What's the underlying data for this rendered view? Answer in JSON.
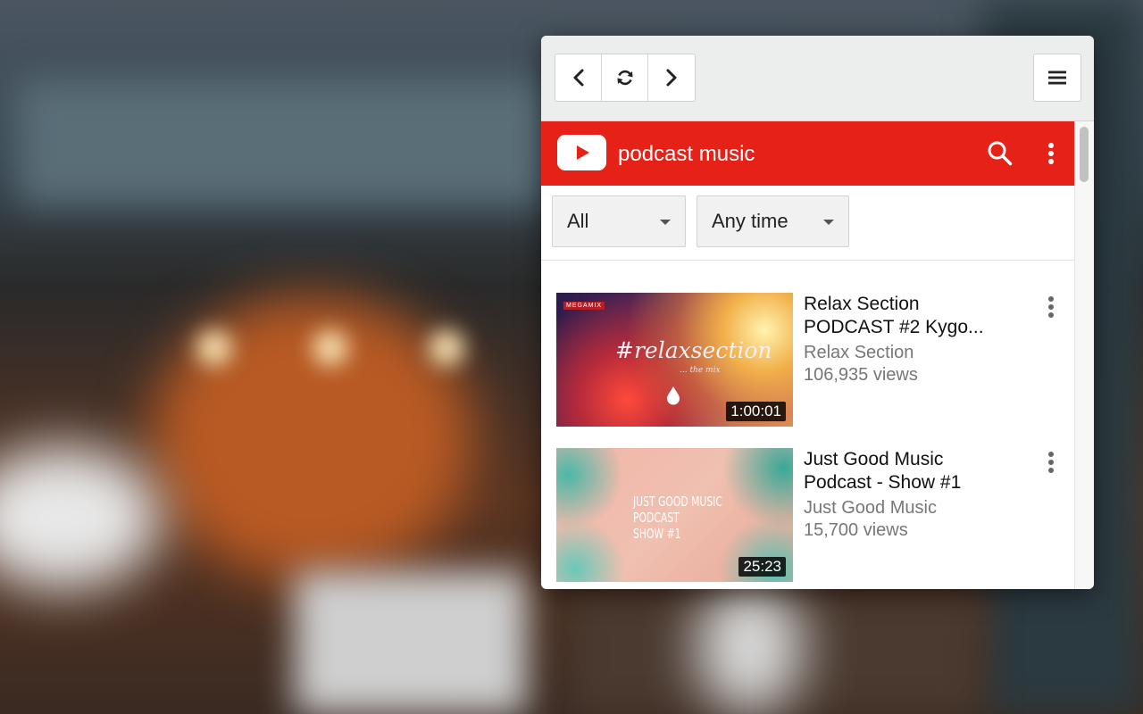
{
  "toolbar": {
    "back": {
      "icon": "chevron-left-icon"
    },
    "reload": {
      "icon": "refresh-icon"
    },
    "forward": {
      "icon": "chevron-right-icon"
    },
    "menu": {
      "icon": "hamburger-menu-icon"
    }
  },
  "youtube": {
    "search_query": "podcast music",
    "brand_color": "#e62117",
    "logo_icon": "youtube-play-icon",
    "search_icon": "search-icon",
    "more_icon": "more-vertical-icon"
  },
  "filters": {
    "type": {
      "selected": "All"
    },
    "time": {
      "selected": "Any time"
    }
  },
  "videos": [
    {
      "title_line1": "Relax Section",
      "title_line2": "PODCAST #2 Kygo...",
      "channel": "Relax Section",
      "views": "106,935 views",
      "duration": "1:00:01",
      "thumb_badge": "MEGAMIX",
      "thumb_text": "#relaxsection",
      "thumb_subtext": "... the mix"
    },
    {
      "title_line1": "Just Good Music",
      "title_line2": "Podcast - Show #1",
      "channel": "Just Good Music",
      "views": "15,700 views",
      "duration": "25:23",
      "thumb_line1": "JUST GOOD MUSIC",
      "thumb_line2": "PODCAST",
      "thumb_line3": "SHOW #1"
    }
  ]
}
